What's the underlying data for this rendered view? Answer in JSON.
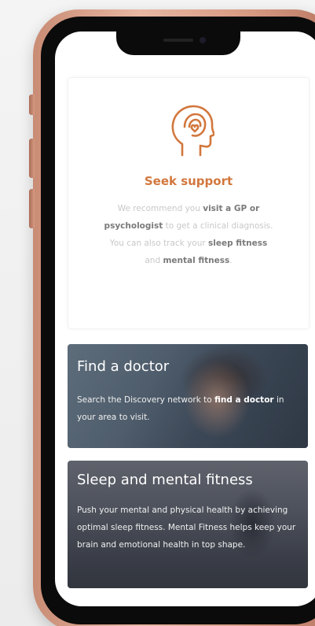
{
  "support": {
    "title": "Seek support",
    "text_1": "We recommend you ",
    "bold_1": "visit a GP or psychologist",
    "text_2": " to get a clinical diagnosis. You can also track your ",
    "bold_2": "sleep fitness",
    "text_3": " and ",
    "bold_3": "mental fitness",
    "text_4": ".",
    "icon": "head-heart-icon",
    "accent_color": "#d2773d"
  },
  "doctor_card": {
    "title": "Find a doctor",
    "text_1": "Search the Discovery network to ",
    "bold_1": "find a doctor",
    "text_2": " in your area to visit."
  },
  "sleep_card": {
    "title": "Sleep and mental fitness",
    "text": "Push your mental and physical health by achieving optimal sleep fitness. Mental Fitness helps keep your brain and emotional health in top shape."
  },
  "phone": {
    "frame_color": "#d79a82"
  }
}
